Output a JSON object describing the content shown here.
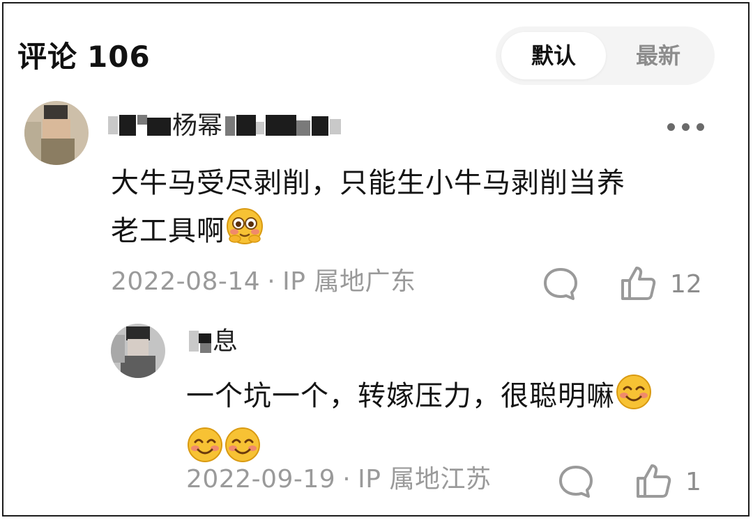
{
  "header": {
    "title": "评论",
    "count": "106",
    "sort_options": [
      "默认",
      "最新"
    ],
    "active_sort": "默认"
  },
  "comments": [
    {
      "author_visible": "杨幂",
      "author_obscured": true,
      "text_line1": "大牛马受尽剥削，只能生小牛马剥削当养",
      "text_line2": "老工具啊",
      "emoji": "flushed-face",
      "date": "2022-08-14",
      "ip": "IP 属地广东",
      "likes": "12"
    }
  ],
  "replies": [
    {
      "author_visible": "息",
      "author_obscured": true,
      "text_line1": "一个坑一个，转嫁压力，很聪明嘛",
      "emoji": "smiling-face",
      "date": "2022-09-19",
      "ip": "IP 属地江苏",
      "likes": "1"
    }
  ],
  "separator": "·",
  "colors": {
    "text": "#141414",
    "meta": "#9a9a9a",
    "icon": "#9a9a9a",
    "segment_bg": "#f4f4f4",
    "emoji_face": "#f7c234"
  },
  "icons": [
    "more-icon",
    "comment-bubble-icon",
    "thumbs-up-icon",
    "flushed-face-emoji",
    "smiling-face-emoji"
  ]
}
